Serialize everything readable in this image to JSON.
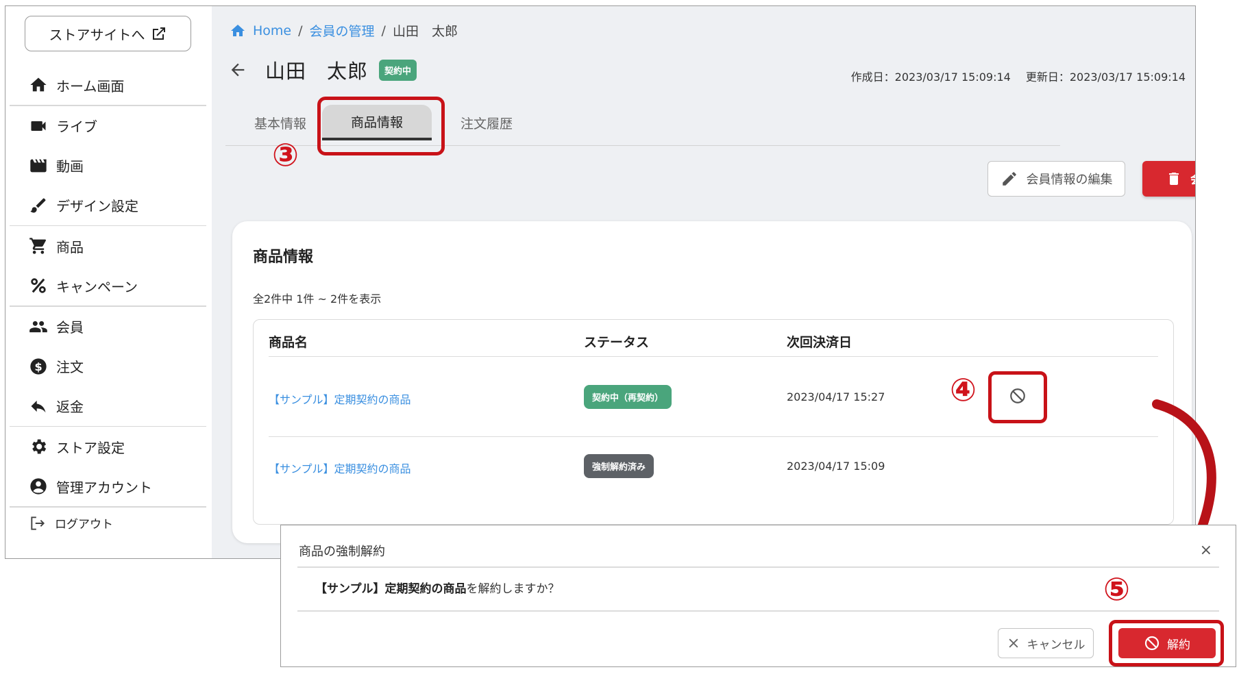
{
  "sidebar": {
    "store_button": "ストアサイトへ",
    "items": [
      {
        "label": "ホーム画面",
        "icon": "home-icon"
      },
      {
        "label": "ライブ",
        "icon": "videocam-icon"
      },
      {
        "label": "動画",
        "icon": "movie-icon"
      },
      {
        "label": "デザイン設定",
        "icon": "brush-icon"
      },
      {
        "label": "商品",
        "icon": "cart-icon"
      },
      {
        "label": "キャンペーン",
        "icon": "percent-icon"
      },
      {
        "label": "会員",
        "icon": "people-icon"
      },
      {
        "label": "注文",
        "icon": "dollar-icon"
      },
      {
        "label": "返金",
        "icon": "reply-icon"
      },
      {
        "label": "ストア設定",
        "icon": "gear-icon"
      },
      {
        "label": "管理アカウント",
        "icon": "account-icon"
      },
      {
        "label": "ログアウト",
        "icon": "logout-icon"
      }
    ]
  },
  "breadcrumb": {
    "home": "Home",
    "sep": "/",
    "members": "会員の管理",
    "current": "山田　太郎"
  },
  "member": {
    "name": "山田　太郎",
    "status": "契約中"
  },
  "dates": {
    "created": "作成日：2023/03/17 15:09:14",
    "updated": "更新日：2023/03/17 15:09:14"
  },
  "tabs": [
    "基本情報",
    "商品情報",
    "注文履歴"
  ],
  "actions": {
    "edit": "会員情報の編集",
    "withdraw": "会員の退会"
  },
  "card": {
    "title": "商品情報",
    "count": "全2件中 1件 ~ 2件を表示",
    "columns": [
      "商品名",
      "ステータス",
      "次回決済日"
    ],
    "rows": [
      {
        "product": "【サンプル】定期契約の商品",
        "status": "契約中（再契約）",
        "next_payment": "2023/04/17 15:27"
      },
      {
        "product": "【サンプル】定期契約の商品",
        "status": "強制解約済み",
        "next_payment": "2023/04/17 15:09"
      }
    ]
  },
  "dialog": {
    "title": "商品の強制解約",
    "close": "×",
    "message_bold": "【サンプル】定期契約の商品",
    "message_rest": "を解約しますか？",
    "cancel": "キャンセル",
    "confirm": "解約"
  },
  "annotations": {
    "step3": "③",
    "step4": "④",
    "step5": "⑤"
  },
  "colors": {
    "accent_red": "#d8282f",
    "highlight_red": "#c81218",
    "status_green": "#4aa57c",
    "link_blue": "#3a8fe0"
  }
}
